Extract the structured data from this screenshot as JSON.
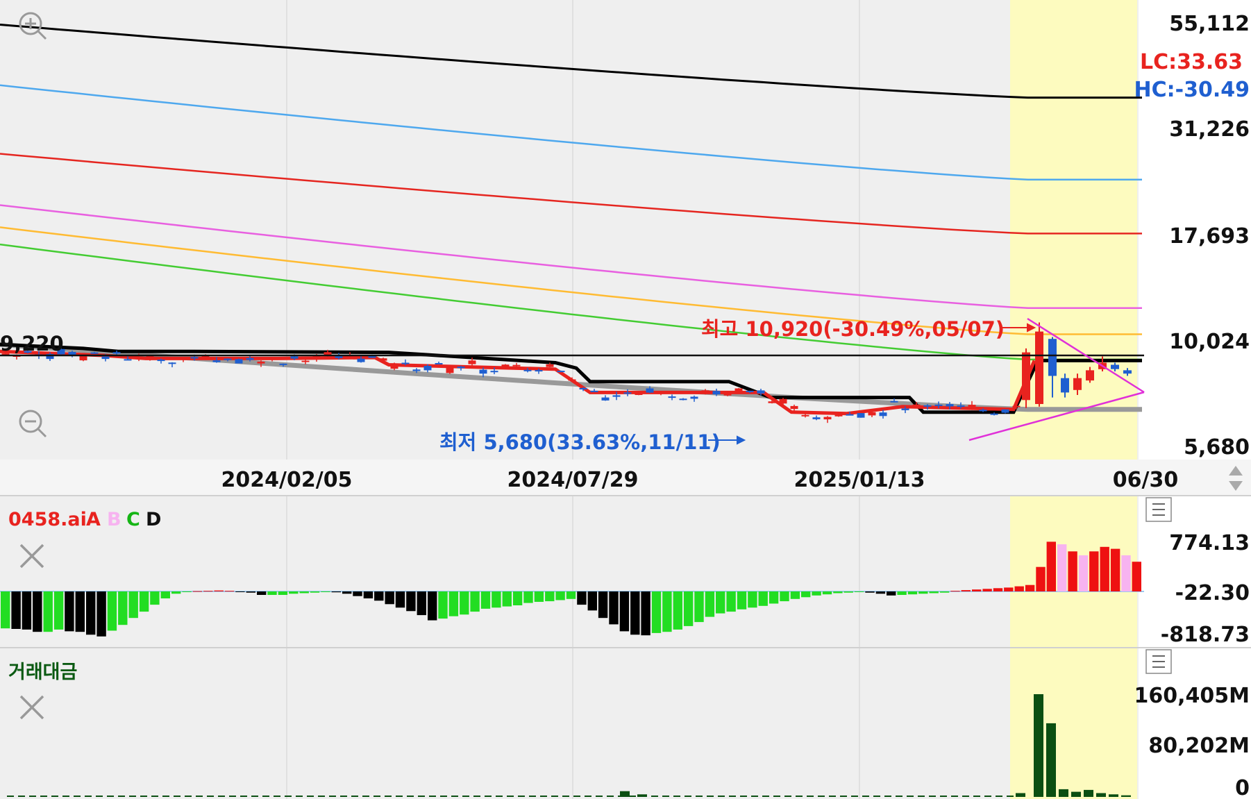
{
  "colors": {
    "panel_bg": "#efefef",
    "highlight": "#fdfbbf",
    "up": "#e8231f",
    "down": "#1f5fd0",
    "lc": "#e8231f",
    "hc": "#1f5fd0",
    "osc_black": "#000000",
    "osc_green": "#22dd22",
    "osc_red": "#ee1111",
    "osc_pink": "#f7b3f0",
    "volume": "#0b4f12",
    "label_A": "#e8231f",
    "label_B": "#f7b3f0",
    "label_C": "#15b515",
    "label_D": "#111111",
    "trading_value_label": "#0b5a12"
  },
  "price_axis": {
    "ticks": [
      "55,112",
      "31,226",
      "17,693",
      "10,024",
      "5,680"
    ],
    "lc_label": "LC:33.63",
    "hc_label": "HC:-30.49"
  },
  "date_axis": {
    "ticks": [
      "2024/02/05",
      "2024/07/29",
      "2025/01/13",
      "06/30"
    ]
  },
  "annotations": {
    "left_value": "9,220",
    "high": "최고 10,920(-30.49%,05/07)",
    "low": "최저 5,680(33.63%,11/11)"
  },
  "oscillator": {
    "title": "0458.ai",
    "labels": [
      "A",
      "B",
      "C",
      "D"
    ],
    "ticks": [
      "774.13",
      "-22.30",
      "-818.73"
    ]
  },
  "volume": {
    "title": "거래대금",
    "ticks": [
      "160,405M",
      "80,202M",
      "0"
    ]
  },
  "icons": {
    "zoom_in": "zoom-in-icon",
    "zoom_out": "zoom-out-icon",
    "close": "close-icon",
    "menu": "menu-icon",
    "scroll": "scroll-arrows-icon"
  },
  "chart_data": {
    "type": "candlestick",
    "price_scale": "log",
    "y_range": [
      5680,
      55112
    ],
    "x_ticks": [
      "2024/02/05",
      "2024/07/29",
      "2025/01/13",
      "06/30"
    ],
    "high_annotation": {
      "value": 10920,
      "change_pct": -30.49,
      "date": "05/07"
    },
    "low_annotation": {
      "value": 5680,
      "change_pct": 33.63,
      "date": "11/11"
    },
    "moving_averages_start_end": [
      {
        "color": "#000000",
        "start": 54000,
        "end": 36500
      },
      {
        "color": "#4ea8ee",
        "start": 39000,
        "end": 23500
      },
      {
        "color": "#e52620",
        "start": 27000,
        "end": 17600
      },
      {
        "color": "#e860e0",
        "start": 20500,
        "end": 11800
      },
      {
        "color": "#ffbb33",
        "start": 18200,
        "end": 10250
      },
      {
        "color": "#44cc33",
        "start": 16600,
        "end": 8950
      },
      {
        "color": "#999999",
        "start": 9700,
        "end": 6850
      }
    ],
    "horizontal_line": 9850,
    "oscillator_range": [
      -818.73,
      774.13
    ],
    "volume_max": 160405
  }
}
